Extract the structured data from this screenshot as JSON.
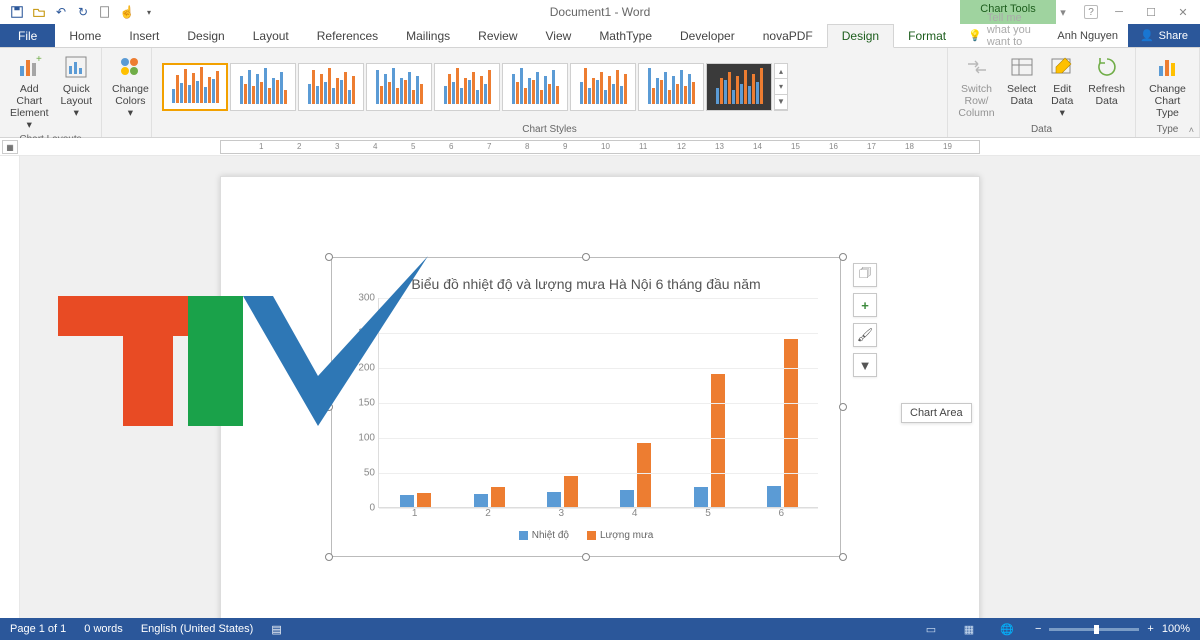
{
  "app": {
    "title": "Document1 - Word",
    "chart_tools": "Chart Tools"
  },
  "qat": [
    "save",
    "open",
    "undo",
    "redo",
    "new",
    "touch"
  ],
  "window": {
    "min": "─",
    "max": "☐",
    "close": "✕",
    "ribbon_opts": "▾",
    "help": "?"
  },
  "tabs": {
    "file": "File",
    "list": [
      "Home",
      "Insert",
      "Design",
      "Layout",
      "References",
      "Mailings",
      "Review",
      "View",
      "MathType",
      "Developer",
      "novaPDF"
    ],
    "ctx": [
      "Design",
      "Format"
    ],
    "active_ctx": "Design",
    "tell_me": "Tell me what you want to do...",
    "user": "Anh Nguyen",
    "share": "Share"
  },
  "ribbon": {
    "groups": {
      "chart_layouts": {
        "label": "Chart Layouts",
        "add_element": "Add Chart\nElement ▾",
        "quick_layout": "Quick\nLayout ▾"
      },
      "colors": {
        "change_colors": "Change\nColors ▾"
      },
      "chart_styles": {
        "label": "Chart Styles"
      },
      "data": {
        "label": "Data",
        "switch": "Switch Row/\nColumn",
        "select": "Select\nData",
        "edit": "Edit\nData ▾",
        "refresh": "Refresh\nData"
      },
      "type": {
        "label": "Type",
        "change_type": "Change\nChart Type"
      }
    }
  },
  "chart": {
    "title": "Biểu đồ nhiệt độ và lượng mưa Hà Nội 6 tháng đầu năm",
    "legend": [
      "Nhiệt độ",
      "Lượng mưa"
    ],
    "tooltip": "Chart Area"
  },
  "status": {
    "page": "Page 1 of 1",
    "words": "0 words",
    "lang": "English (United States)",
    "zoom": "100%"
  },
  "chart_data": {
    "type": "bar",
    "title": "Biểu đồ nhiệt độ và lượng mưa Hà Nội 6 tháng đầu năm",
    "categories": [
      "1",
      "2",
      "3",
      "4",
      "5",
      "6"
    ],
    "series": [
      {
        "name": "Nhiệt độ",
        "values": [
          17,
          18,
          21,
          25,
          28,
          30
        ],
        "color": "#5b9bd5"
      },
      {
        "name": "Lượng mưa",
        "values": [
          20,
          28,
          45,
          92,
          190,
          240
        ],
        "color": "#ed7d31"
      }
    ],
    "xlabel": "",
    "ylabel": "",
    "ylim": [
      0,
      300
    ],
    "yticks": [
      0,
      50,
      100,
      150,
      200,
      250,
      300
    ],
    "legend_position": "bottom",
    "grid": true
  }
}
